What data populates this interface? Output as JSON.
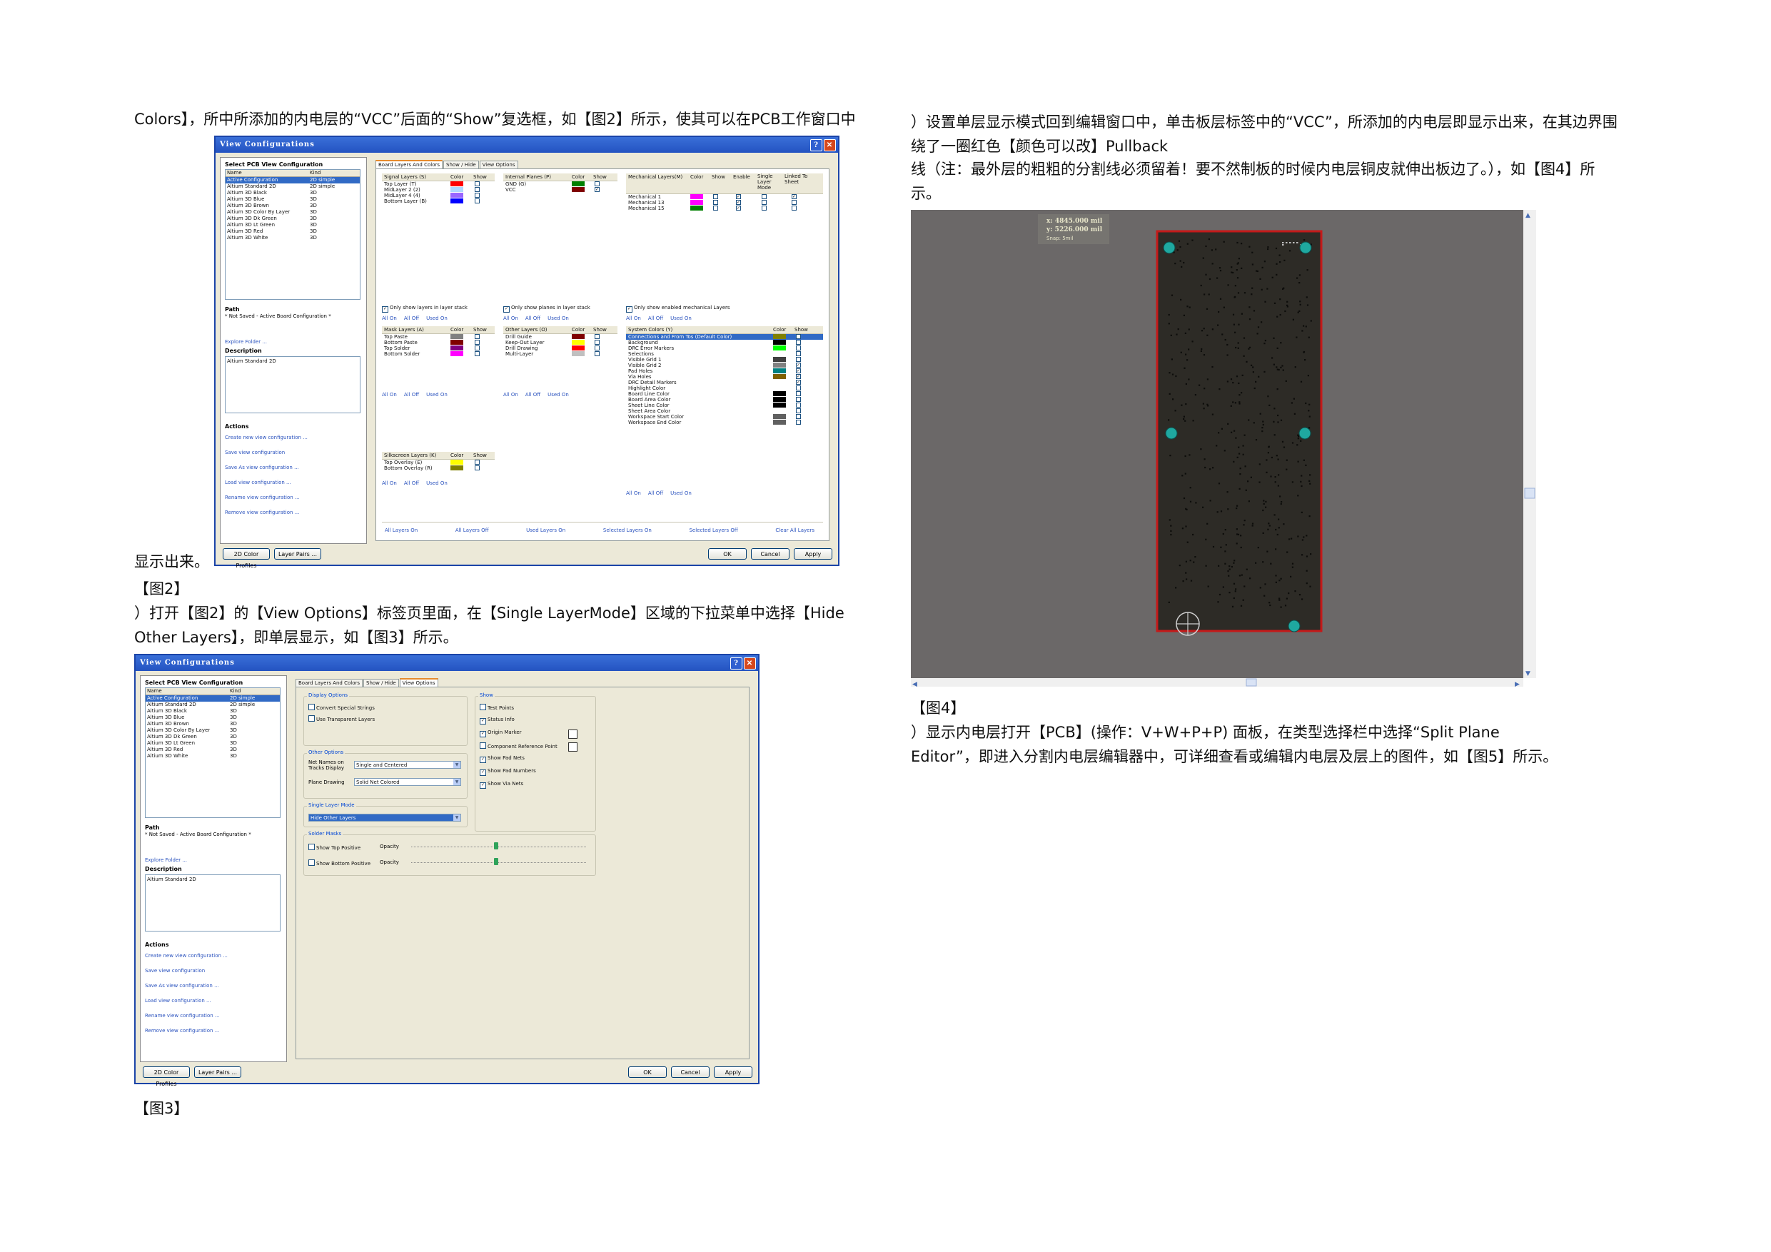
{
  "text": {
    "p1": "Colors】，所中所添加的内电层的“VCC”后面的“Show”复选框，如【图2】所示，使其可以在PCB工作窗口中",
    "p2": "显示出来。",
    "cap2": "【图2】",
    "p3a": "）打开【图2】的【View Options】标签页里面，在【Single LayerMode】区域的下拉菜单中选择【Hide",
    "p3b": "Other Layers】，即单层显示，如【图3】所示。",
    "cap3": "【图3】",
    "r1a": "）设置单层显示模式回到编辑窗口中，单击板层标签中的“VCC”，所添加的内电层即显示出来，在其边界围",
    "r1b": "绕了一圈红色【颜色可以改】Pullback",
    "r1c": "线（注：最外层的粗粗的分割线必须留着！要不然制板的时候内电层铜皮就伸出板边了。），如【图4】所",
    "r1d": "示。",
    "cap4": "【图4】",
    "r2a": "）显示内电层打开【PCB】(操作：V+W+P+P) 面板，在类型选择栏中选择“Split Plane",
    "r2b": "Editor”，即进入分割内电层编辑器中，可详细查看或编辑内电层及层上的图件，如【图5】所示。"
  },
  "dialog": {
    "title": "View Configurations",
    "select_label": "Select PCB View Configuration",
    "col_name": "Name",
    "col_kind": "Kind",
    "configs": [
      {
        "name": "Active Configuration",
        "kind": "2D simple"
      },
      {
        "name": "Altium Standard 2D",
        "kind": "2D simple"
      },
      {
        "name": "Altium 3D Black",
        "kind": "3D"
      },
      {
        "name": "Altium 3D Blue",
        "kind": "3D"
      },
      {
        "name": "Altium 3D Brown",
        "kind": "3D"
      },
      {
        "name": "Altium 3D Color By Layer",
        "kind": "3D"
      },
      {
        "name": "Altium 3D Dk Green",
        "kind": "3D"
      },
      {
        "name": "Altium 3D Lt Green",
        "kind": "3D"
      },
      {
        "name": "Altium 3D Red",
        "kind": "3D"
      },
      {
        "name": "Altium 3D White",
        "kind": "3D"
      }
    ],
    "path_label": "Path",
    "path_value": "* Not Saved - Active Board Configuration *",
    "explore": "Explore Folder ...",
    "desc_label": "Description",
    "desc_value": "Altium Standard 2D",
    "actions_label": "Actions",
    "actions": [
      "Create new view configuration ...",
      "Save view configuration",
      "Save As view configuration ...",
      "Load view configuration ...",
      "Rename view configuration ...",
      "Remove view configuration ..."
    ],
    "btn_profiles": "2D Color Profiles",
    "btn_pairs": "Layer Pairs ...",
    "btn_ok": "OK",
    "btn_cancel": "Cancel",
    "btn_apply": "Apply",
    "tabs": [
      "Board Layers And Colors",
      "Show / Hide",
      "View Options"
    ]
  },
  "fig2": {
    "color": "Color",
    "show": "Show",
    "enable": "Enable",
    "single_layer_mode": "Single Layer Mode",
    "linked_to_sheet": "Linked To Sheet",
    "all_on": "All On",
    "all_off": "All Off",
    "used_on": "Used On",
    "signal_hdr": "Signal Layers (S)",
    "signal": [
      {
        "name": "Top Layer (T)",
        "color": "#ff0000"
      },
      {
        "name": "MidLayer 2 (2)",
        "color": "#b0d8ff"
      },
      {
        "name": "MidLayer 4 (4)",
        "color": "#9966ff"
      },
      {
        "name": "Bottom Layer (B)",
        "color": "#0000ff"
      }
    ],
    "planes_hdr": "Internal Planes (P)",
    "planes": [
      {
        "name": "GND (G)",
        "color": "#008000",
        "show": ""
      },
      {
        "name": "VCC",
        "color": "#800000",
        "show": "✓"
      }
    ],
    "mech_hdr": "Mechanical Layers(M)",
    "mech": [
      {
        "name": "Mechanical 1",
        "color": "#ff00ff",
        "enable": "✓",
        "linked": "✓"
      },
      {
        "name": "Mechanical 13",
        "color": "#ff00ff",
        "enable": "✓",
        "linked": ""
      },
      {
        "name": "Mechanical 15",
        "color": "#008000",
        "enable": "✓",
        "linked": ""
      }
    ],
    "only_layers": "Only show layers in layer stack",
    "only_planes": "Only show planes in layer stack",
    "only_mech": "Only show enabled mechanical Layers",
    "mask_hdr": "Mask Layers (A)",
    "mask": [
      {
        "name": "Top Paste",
        "color": "#808080"
      },
      {
        "name": "Bottom Paste",
        "color": "#800000"
      },
      {
        "name": "Top Solder",
        "color": "#800080"
      },
      {
        "name": "Bottom Solder",
        "color": "#ff00ff"
      }
    ],
    "other_hdr": "Other Layers (O)",
    "other": [
      {
        "name": "Drill Guide",
        "color": "#800000"
      },
      {
        "name": "Keep-Out Layer",
        "color": "#ffff00"
      },
      {
        "name": "Drill Drawing",
        "color": "#ff0000"
      },
      {
        "name": "Multi-Layer",
        "color": "#c0c0c0"
      }
    ],
    "sys_hdr": "System Colors (Y)",
    "sys": [
      {
        "name": "Connections and From Tos (Default Color)",
        "color": "#808000",
        "show": "✓"
      },
      {
        "name": "Background",
        "color": "#000000",
        "show": ""
      },
      {
        "name": "DRC Error Markers",
        "color": "#00ff00",
        "show": ""
      },
      {
        "name": "Selections",
        "color": "#ffffff",
        "show": ""
      },
      {
        "name": "Visible Grid 1",
        "color": "#404040",
        "show": ""
      },
      {
        "name": "Visible Grid 2",
        "color": "#808080",
        "show": "✓"
      },
      {
        "name": "Pad Holes",
        "color": "#008080",
        "show": "✓"
      },
      {
        "name": "Via Holes",
        "color": "#806000",
        "show": "✓"
      },
      {
        "name": "DRC Detail Markers",
        "color": "#ffffff",
        "show": "✓"
      },
      {
        "name": "Highlight Color",
        "color": "#ffffff",
        "show": ""
      },
      {
        "name": "Board Line Color",
        "color": "#000000",
        "show": ""
      },
      {
        "name": "Board Area Color",
        "color": "#000000",
        "show": ""
      },
      {
        "name": "Sheet Line Color",
        "color": "#000000",
        "show": ""
      },
      {
        "name": "Sheet Area Color",
        "color": "#ffffff",
        "show": ""
      },
      {
        "name": "Workspace Start Color",
        "color": "#606060",
        "show": ""
      },
      {
        "name": "Workspace End Color",
        "color": "#606060",
        "show": ""
      }
    ],
    "silk_hdr": "Silkscreen Layers (K)",
    "silk": [
      {
        "name": "Top Overlay (E)",
        "color": "#ffff00"
      },
      {
        "name": "Bottom Overlay (R)",
        "color": "#808000"
      }
    ],
    "bottom_links": [
      "All Layers On",
      "All Layers Off",
      "Used Layers On",
      "Selected Layers On",
      "Selected Layers Off",
      "Clear All Layers"
    ]
  },
  "fig3": {
    "display_options": "Display Options",
    "convert_special": "Convert Special Strings",
    "use_transparent": "Use Transparent Layers",
    "other_options": "Other Options",
    "net_names_label": "Net Names on Tracks Display",
    "net_names_value": "Single and Centered",
    "plane_drawing_label": "Plane Drawing",
    "plane_drawing_value": "Solid Net Colored",
    "single_layer_mode": "Single Layer Mode",
    "single_layer_value": "Hide Other Layers",
    "solder_masks": "Solder Masks",
    "show_top_positive": "Show Top Positive",
    "show_bottom_positive": "Show Bottom Positive",
    "opacity": "Opacity",
    "show": "Show",
    "show_items": [
      {
        "label": "Test Points",
        "checked": ""
      },
      {
        "label": "Status Info",
        "checked": "✓"
      },
      {
        "label": "Origin Marker",
        "checked": "✓"
      },
      {
        "label": "Component Reference Point",
        "checked": ""
      },
      {
        "label": "Show Pad Nets",
        "checked": "✓"
      },
      {
        "label": "Show Pad Numbers",
        "checked": "✓"
      },
      {
        "label": "Show Via Nets",
        "checked": "✓"
      }
    ]
  },
  "fig4": {
    "coord_x": "x:  4845.000 mil",
    "coord_y": "y:  5226.000 mil",
    "snap": "Snap: 5mil",
    "background": "#6b6868",
    "board": "#2d2b26",
    "pullback": "#c41a1a",
    "hole": "#1fa8a0"
  }
}
